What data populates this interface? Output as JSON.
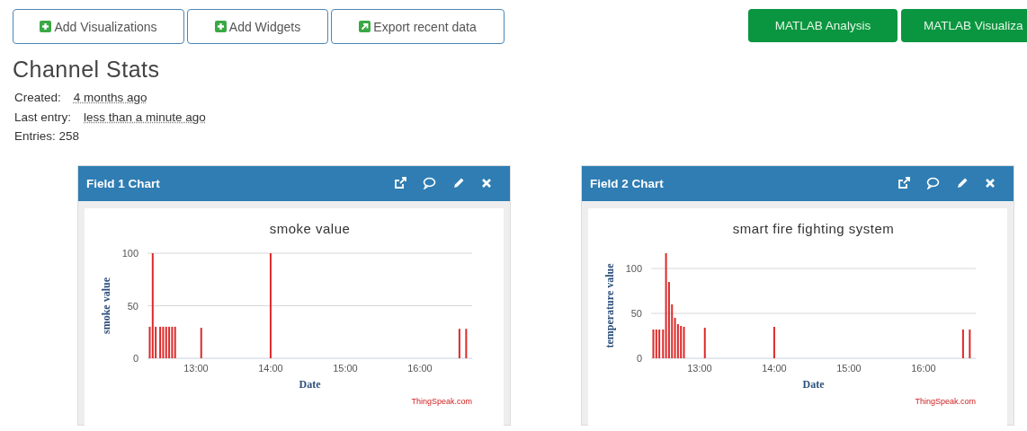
{
  "toolbar": {
    "buttons": [
      {
        "label": "Add Visualizations"
      },
      {
        "label": "Add Widgets"
      },
      {
        "label": "Export recent data"
      }
    ],
    "matlab_buttons": [
      "MATLAB Analysis",
      "MATLAB Visualiza"
    ]
  },
  "stats": {
    "title": "Channel Stats",
    "rows": [
      {
        "label": "Created:",
        "value": "4 months ago"
      },
      {
        "label": "Last entry:",
        "value": "less than a minute ago"
      },
      {
        "label": "Entries: 258"
      }
    ]
  },
  "panels": [
    {
      "title": "Field 1 Chart",
      "credit": "ThingSpeak.com",
      "chart_data": {
        "type": "bar",
        "title": "smoke value",
        "xlabel": "Date",
        "ylabel": "smoke value",
        "x": [
          12.38,
          12.42,
          12.46,
          12.52,
          12.56,
          12.6,
          12.64,
          12.68,
          12.72,
          13.07,
          14.0,
          16.53,
          16.62
        ],
        "series": [
          {
            "color": "#dd2a2a",
            "values": [
              30,
              100,
              30,
              30,
              30,
              30,
              30,
              30,
              30,
              29,
              100,
              28,
              28
            ]
          }
        ],
        "xlim": [
          12.35,
          16.7
        ],
        "ylim": [
          0,
          100
        ],
        "xticks": [
          {
            "value": 13,
            "label": "13:00"
          },
          {
            "value": 14,
            "label": "14:00"
          },
          {
            "value": 15,
            "label": "15:00"
          },
          {
            "value": 16,
            "label": "16:00"
          }
        ],
        "yticks": [
          0,
          50,
          100
        ]
      }
    },
    {
      "title": "Field 2 Chart",
      "credit": "ThingSpeak.com",
      "chart_data": {
        "type": "bar",
        "title": "smart fire fighting system",
        "xlabel": "Date",
        "ylabel": "temperature value",
        "x": [
          12.38,
          12.42,
          12.46,
          12.51,
          12.55,
          12.59,
          12.63,
          12.67,
          12.71,
          12.75,
          12.79,
          13.07,
          14.0,
          16.53,
          16.62
        ],
        "series": [
          {
            "color": "#dd2a2a",
            "values": [
              32,
              32,
              32,
              32,
              117,
              85,
              60,
              45,
              38,
              36,
              35,
              34,
              35,
              32,
              32
            ]
          }
        ],
        "xlim": [
          12.35,
          16.7
        ],
        "ylim": [
          0,
          117
        ],
        "xticks": [
          {
            "value": 13,
            "label": "13:00"
          },
          {
            "value": 14,
            "label": "14:00"
          },
          {
            "value": 15,
            "label": "15:00"
          },
          {
            "value": 16,
            "label": "16:00"
          }
        ],
        "yticks": [
          0,
          50,
          100
        ]
      }
    }
  ]
}
